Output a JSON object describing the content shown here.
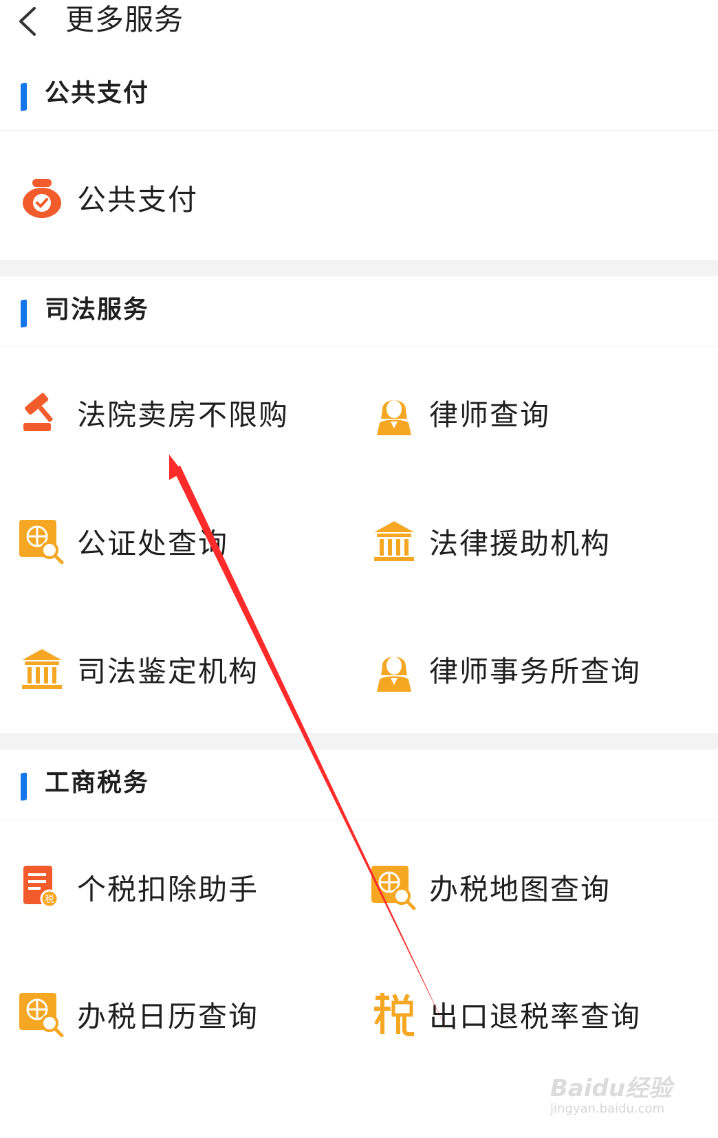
{
  "header": {
    "title": "更多服务",
    "back_icon": "chevron-left-icon"
  },
  "sections": [
    {
      "title": "公共支付",
      "items": [
        {
          "label": "公共支付",
          "icon": "payment-bag-icon"
        }
      ]
    },
    {
      "title": "司法服务",
      "items": [
        {
          "label": "法院卖房不限购",
          "icon": "gavel-icon"
        },
        {
          "label": "律师查询",
          "icon": "lawyer-icon"
        },
        {
          "label": "公证处查询",
          "icon": "globe-search-icon"
        },
        {
          "label": "法律援助机构",
          "icon": "institution-icon"
        },
        {
          "label": "司法鉴定机构",
          "icon": "institution-icon"
        },
        {
          "label": "律师事务所查询",
          "icon": "lawyer-icon"
        }
      ]
    },
    {
      "title": "工商税务",
      "items": [
        {
          "label": "个税扣除助手",
          "icon": "tax-document-icon"
        },
        {
          "label": "办税地图查询",
          "icon": "globe-search-icon"
        },
        {
          "label": "办税日历查询",
          "icon": "globe-search-icon"
        },
        {
          "label": "出口退税率查询",
          "icon": "tax-character-icon"
        }
      ]
    }
  ],
  "watermark": {
    "brand": "Baidu经验",
    "url": "jingyan.baidu.com"
  },
  "colors": {
    "accent_bar": "#1577ea",
    "icon_orange": "#f5a623",
    "icon_red": "#f25c2c",
    "annotation_arrow": "#ff2a2a"
  }
}
